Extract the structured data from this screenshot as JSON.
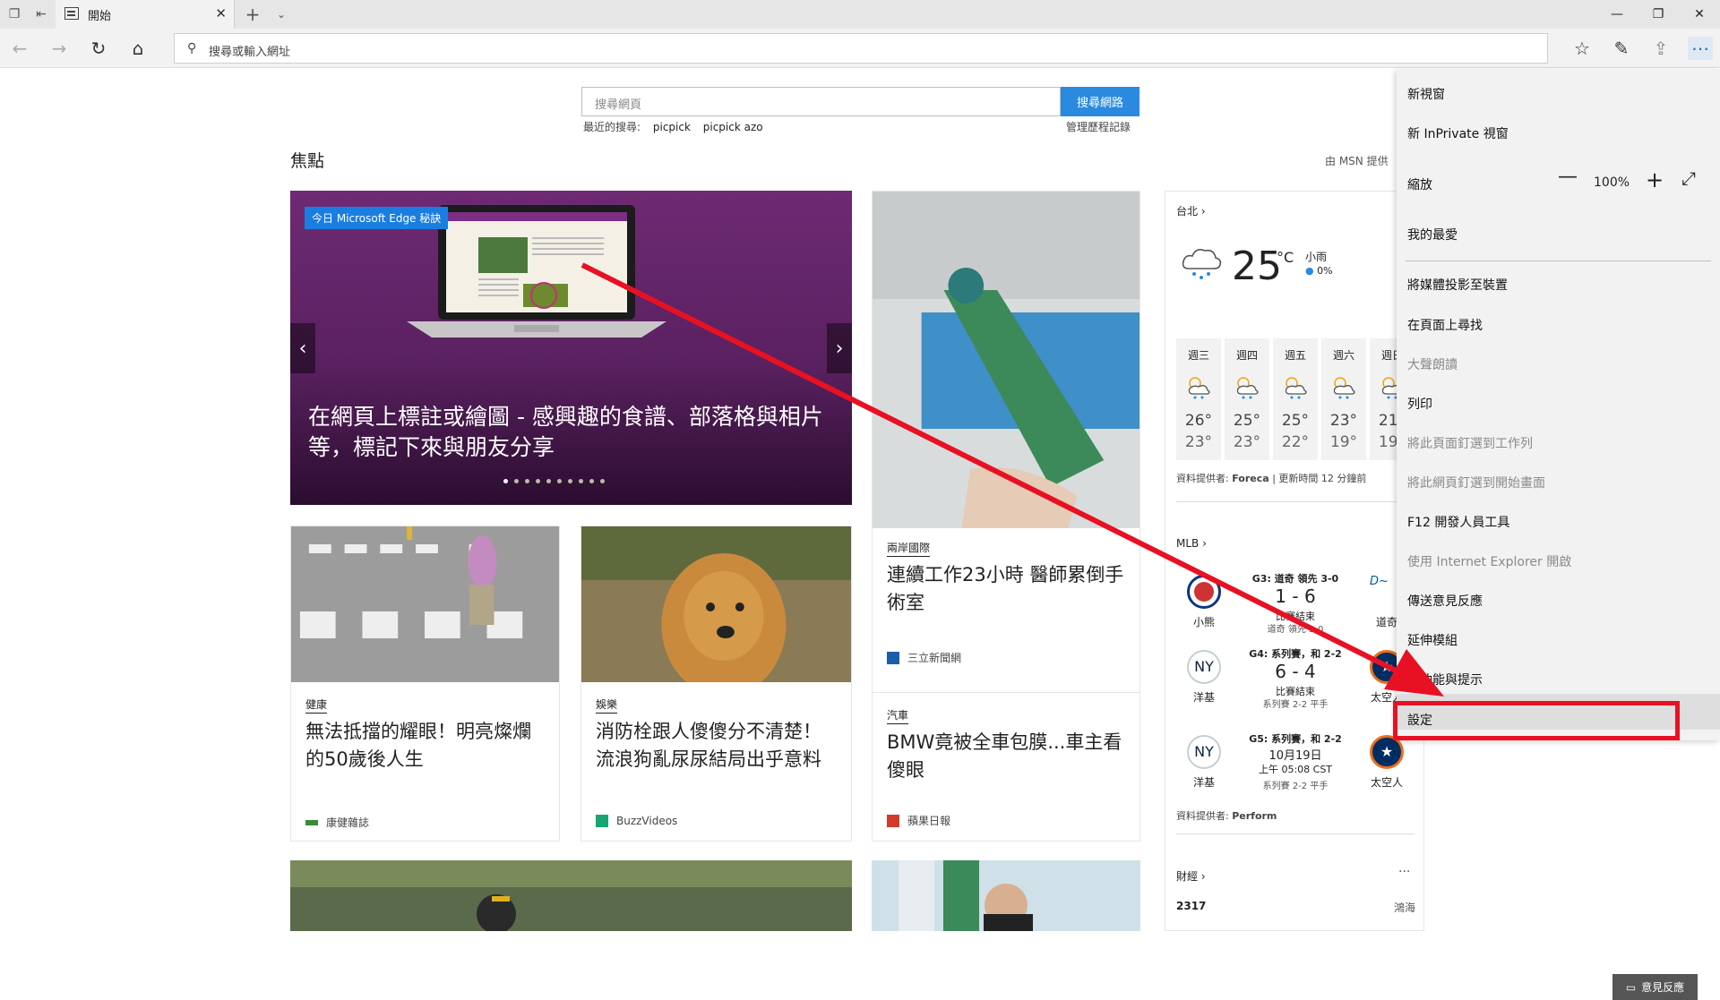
{
  "browser": {
    "tab_title": "開始",
    "new_tab_label": "+",
    "tab_menu_icon": "chevron-down-icon",
    "address_placeholder": "搜尋或輸入網址"
  },
  "search": {
    "placeholder": "搜尋網頁",
    "button": "搜尋網路",
    "recent_label": "最近的搜尋:",
    "recent_items": [
      "picpick",
      "picpick azo"
    ],
    "history_link": "管理歷程記錄"
  },
  "feed": {
    "section_title": "焦點",
    "provider": "由 MSN 提供",
    "hero": {
      "badge": "今日 Microsoft Edge 秘訣",
      "title": "在網頁上標註或繪圖 - 感興趣的食譜、部落格與相片等，標記下來與朋友分享",
      "dot_count": 10
    },
    "cards": [
      {
        "category": "兩岸國際",
        "title": "連續工作23小時 醫師累倒手術室",
        "source": "三立新聞網"
      },
      {
        "category": "健康",
        "title": "無法抵擋的耀眼！明亮燦爛的50歲後人生",
        "source": "康健雜誌"
      },
      {
        "category": "娛樂",
        "title": "消防栓跟人傻傻分不清楚！ 流浪狗亂尿尿結局出乎意料",
        "source": "BuzzVideos"
      },
      {
        "category": "汽車",
        "title": "BMW竟被全車包膜...車主看傻眼",
        "source": "蘋果日報"
      }
    ]
  },
  "weather": {
    "city": "台北",
    "temp": "25",
    "unit": "°C",
    "condition": "小雨",
    "precip": "0%",
    "days": [
      {
        "day": "週三",
        "hi": "26°",
        "lo": "23°"
      },
      {
        "day": "週四",
        "hi": "25°",
        "lo": "23°"
      },
      {
        "day": "週五",
        "hi": "25°",
        "lo": "22°"
      },
      {
        "day": "週六",
        "hi": "23°",
        "lo": "19°"
      },
      {
        "day": "週日",
        "hi": "21°",
        "lo": "19°"
      }
    ],
    "provider_label": "資料提供者:",
    "provider": "Foreca",
    "updated": "| 更新時間 12 分鐘前"
  },
  "mlb": {
    "title": "MLB",
    "games": [
      {
        "header": "G3: 道奇 領先 3-0",
        "score": "1 - 6",
        "status": "比賽結束",
        "sub": "道奇 領先 3-0",
        "home": "小熊",
        "away": "道奇"
      },
      {
        "header": "G4: 系列賽，和 2-2",
        "score": "6 - 4",
        "status": "比賽結束",
        "sub": "系列賽 2-2 平手",
        "home": "洋基",
        "away": "太空人"
      },
      {
        "header": "G5: 系列賽，和 2-2",
        "score": "10月19日",
        "status": "上午 05:08 CST",
        "sub": "系列賽 2-2 平手",
        "home": "洋基",
        "away": "太空人"
      }
    ],
    "provider_label": "資料提供者:",
    "provider": "Perform"
  },
  "finance": {
    "title": "財經",
    "value": "2317",
    "label": "鴻海"
  },
  "menu": {
    "new_window": "新視窗",
    "new_private": "新 InPrivate 視窗",
    "zoom_label": "縮放",
    "zoom_value": "100%",
    "favorites": "我的最愛",
    "cast": "將媒體投影至裝置",
    "find": "在頁面上尋找",
    "read_aloud": "大聲朗讀",
    "print": "列印",
    "pin_taskbar": "將此頁面釘選到工作列",
    "pin_start": "將此網頁釘選到開始畫面",
    "devtools": "F12 開發人員工具",
    "open_ie": "使用 Internet Explorer 開啟",
    "feedback": "傳送意見反應",
    "extensions": "延伸模組",
    "tips": "新功能與提示",
    "settings": "設定"
  },
  "feedback_button": "意見反應",
  "colors": {
    "accent": "#2a8ae0",
    "annotation": "#e81123",
    "hero_bg": "#6e2a73"
  }
}
